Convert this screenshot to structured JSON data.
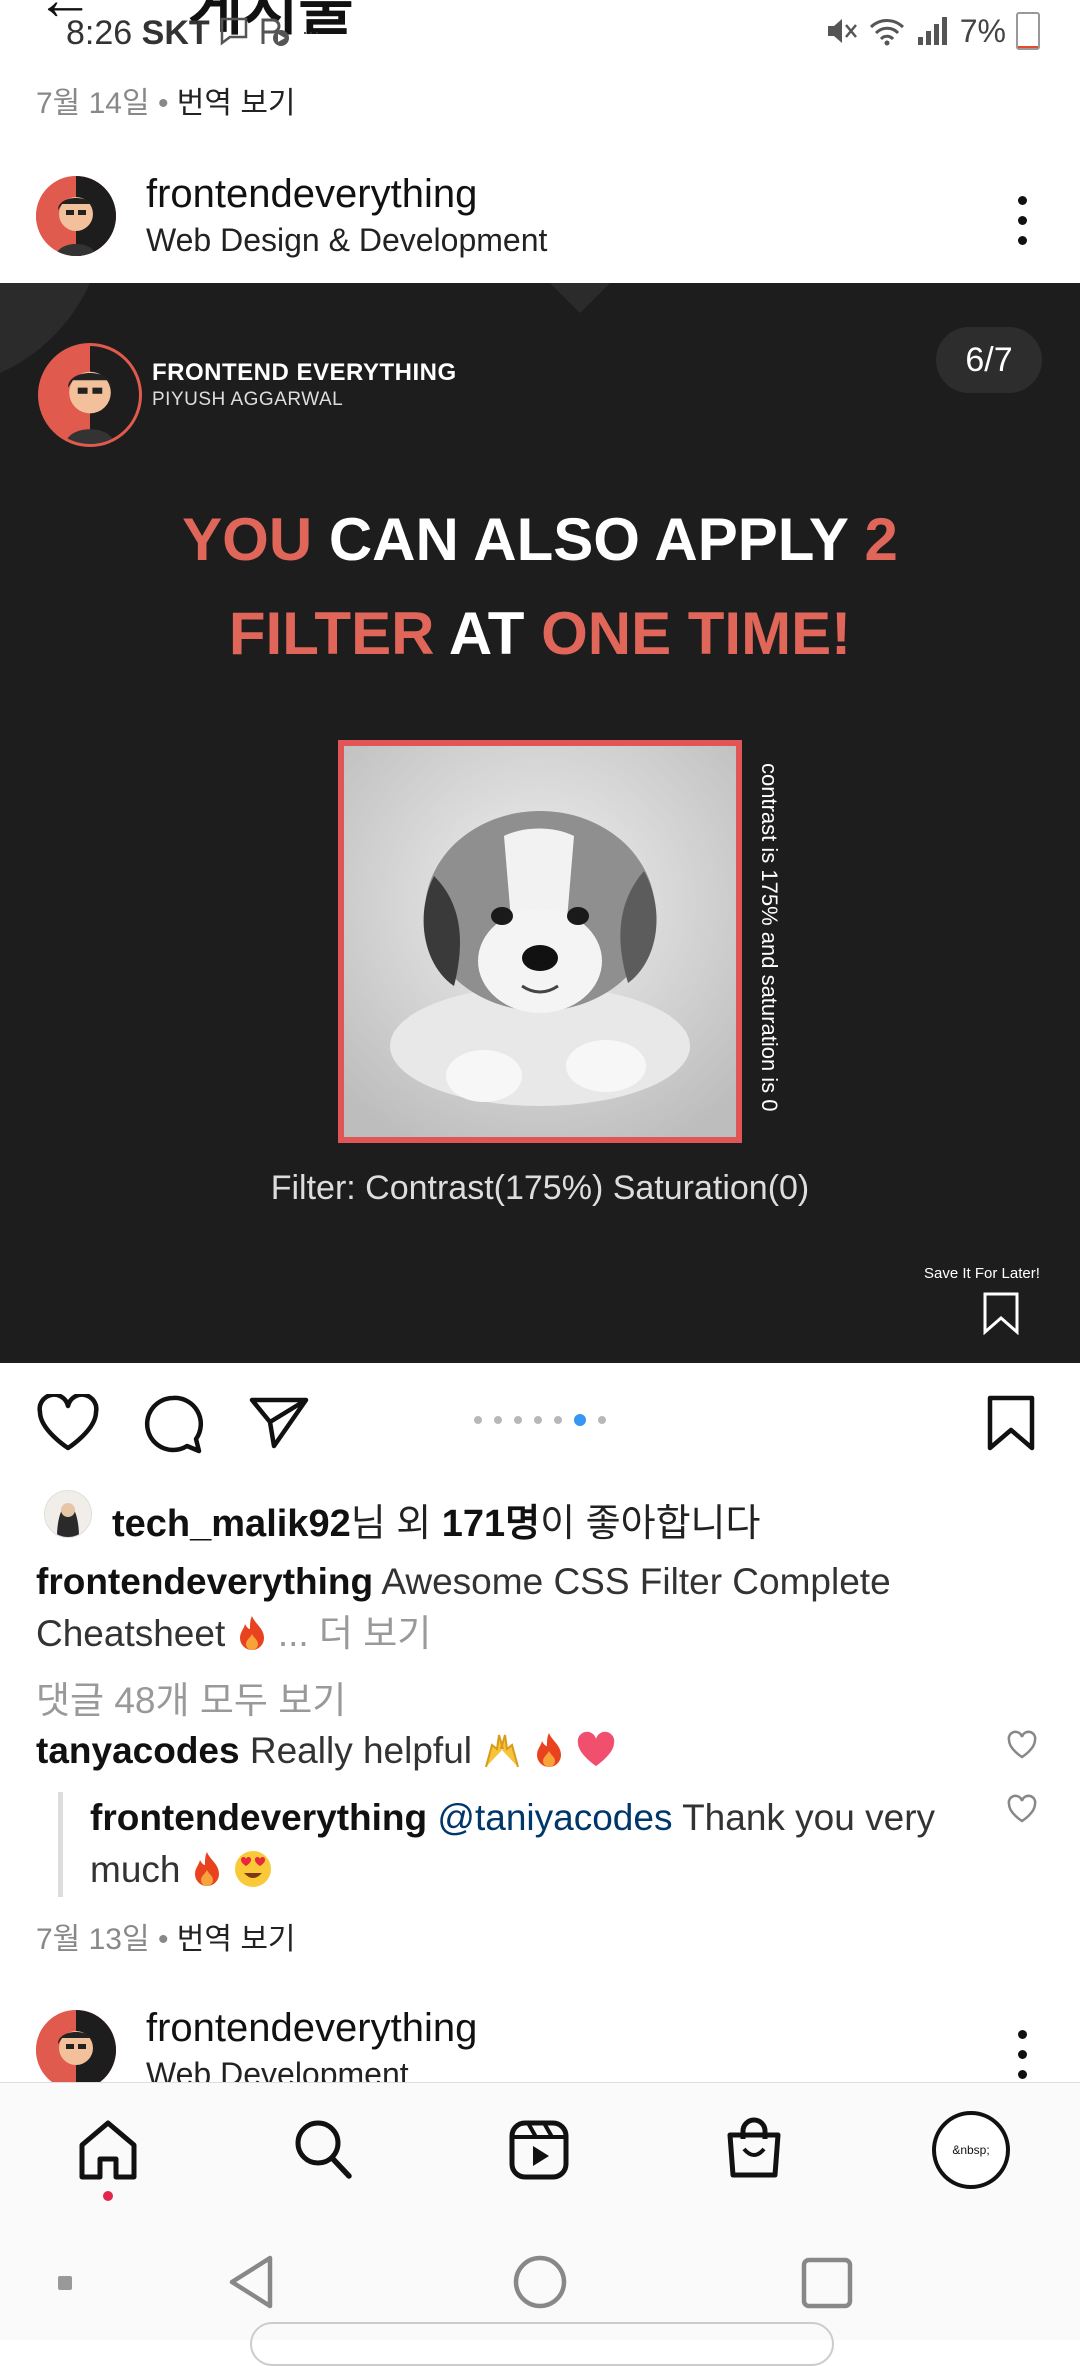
{
  "status_bar": {
    "time": "8:26",
    "carrier": "SKT",
    "extra": "···",
    "battery_percent": "7%",
    "battery_level": 0.07
  },
  "top_bar": {
    "title": "게시물"
  },
  "top_date": {
    "date": "7월 14일",
    "separator": "•",
    "translate": "번역 보기"
  },
  "post": {
    "username": "frontendeverything",
    "subtitle": "Web Design & Development",
    "card": {
      "brand": "FRONTEND EVERYTHING",
      "author": "PIYUSH AGGARWAL",
      "counter": "6/7",
      "headline_parts": [
        "YOU",
        " CAN ALSO APPLY ",
        "2",
        "FILTER",
        " AT ",
        "ONE TIME!"
      ],
      "vertical_text": "contrast is 175% and saturation is 0",
      "filter_caption": "Filter: Contrast(175%) Saturation(0)",
      "save_later": "Save It For Later!"
    },
    "carousel": {
      "total": 7,
      "active": 6
    },
    "likes": {
      "user": "tech_malik92",
      "mid": "님 외 ",
      "count": "171명",
      "tail": "이 좋아합니다"
    },
    "caption": {
      "username": "frontendeverything",
      "text": " Awesome CSS Filter Complete Cheatsheet",
      "more": "... 더 보기"
    },
    "comments_link": "댓글 48개 모두 보기",
    "comment": {
      "username": "tanyacodes",
      "text": " Really helpful"
    },
    "reply": {
      "username": "frontendeverything",
      "mention": "@taniyacodes",
      "text": " Thank you very much"
    },
    "date": "7월 13일",
    "separator": "•",
    "translate": "번역 보기"
  },
  "next_post": {
    "username": "frontendeverything",
    "subtitle": "Web Development"
  },
  "profile_avatar_text": "&nbsp;",
  "icons": {
    "like": "heart-icon",
    "comment": "comment-icon",
    "share": "send-icon",
    "save": "bookmark-icon",
    "nav": [
      "home-icon",
      "search-icon",
      "reels-icon",
      "shop-icon",
      "profile-icon"
    ]
  },
  "colors": {
    "accent_red": "#e0665a",
    "card_bg": "#1d1d1d",
    "link_blue": "#00376b",
    "carousel_active": "#3897f0"
  }
}
